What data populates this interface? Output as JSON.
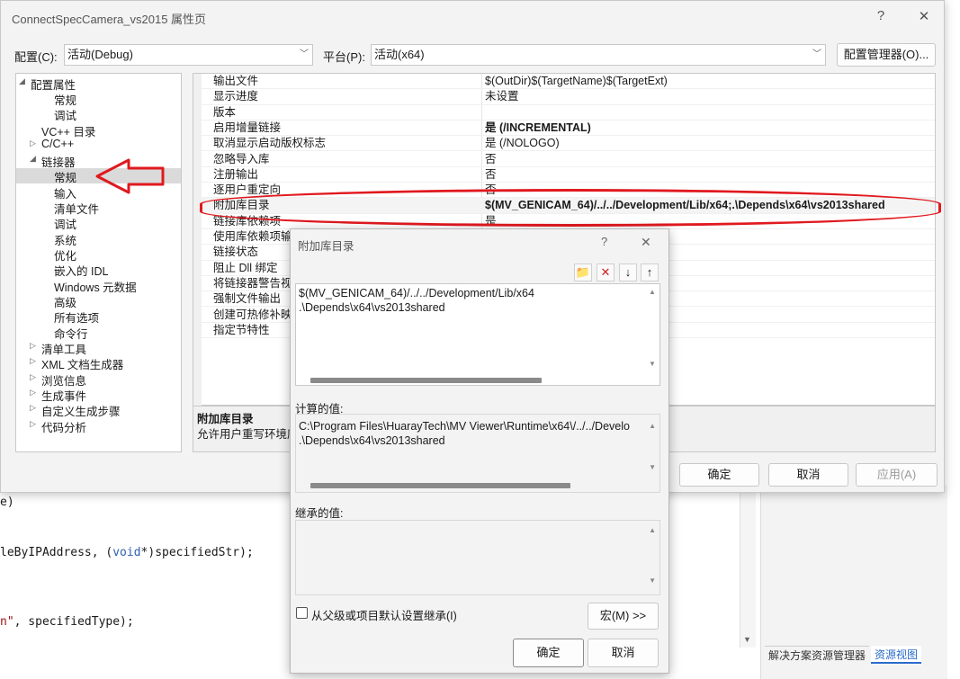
{
  "background": {
    "code_lines": [
      {
        "pre": "",
        "kw": "",
        "post": "e)"
      },
      {
        "pre": "leByIPAddress, (",
        "kw": "void",
        "post": "*)specifiedStr);"
      },
      {
        "pre": "",
        "kw": "",
        "str": "n\"",
        "post": ", specifiedType);"
      }
    ],
    "side_tabs": [
      "解决方案资源管理器",
      "资源视图"
    ]
  },
  "dialog": {
    "title": "ConnectSpecCamera_vs2015 属性页",
    "help_glyph": "?",
    "close_glyph": "✕",
    "config_label": "配置(C):",
    "config_value": "活动(Debug)",
    "platform_label": "平台(P):",
    "platform_value": "活动(x64)",
    "config_manager_button": "配置管理器(O)...",
    "tree": {
      "root": "配置属性",
      "items": [
        {
          "label": "常规"
        },
        {
          "label": "调试"
        },
        {
          "label": "VC++ 目录"
        },
        {
          "label": "C/C++"
        },
        {
          "label": "链接器"
        },
        {
          "label": "常规"
        },
        {
          "label": "输入"
        },
        {
          "label": "清单文件"
        },
        {
          "label": "调试"
        },
        {
          "label": "系统"
        },
        {
          "label": "优化"
        },
        {
          "label": "嵌入的 IDL"
        },
        {
          "label": "Windows 元数据"
        },
        {
          "label": "高级"
        },
        {
          "label": "所有选项"
        },
        {
          "label": "命令行"
        },
        {
          "label": "清单工具"
        },
        {
          "label": "XML 文档生成器"
        },
        {
          "label": "浏览信息"
        },
        {
          "label": "生成事件"
        },
        {
          "label": "自定义生成步骤"
        },
        {
          "label": "代码分析"
        }
      ]
    },
    "properties": [
      {
        "name": "输出文件",
        "value": "$(OutDir)$(TargetName)$(TargetExt)"
      },
      {
        "name": "显示进度",
        "value": "未设置"
      },
      {
        "name": "版本",
        "value": ""
      },
      {
        "name": "启用增量链接",
        "value": "是 (/INCREMENTAL)"
      },
      {
        "name": "取消显示启动版权标志",
        "value": "是 (/NOLOGO)"
      },
      {
        "name": "忽略导入库",
        "value": "否"
      },
      {
        "name": "注册输出",
        "value": "否"
      },
      {
        "name": "逐用户重定向",
        "value": "否"
      },
      {
        "name": "附加库目录",
        "value": "$(MV_GENICAM_64)/../../Development/Lib/x64;.\\Depends\\x64\\vs2013shared"
      },
      {
        "name": "链接库依赖项",
        "value": "是"
      },
      {
        "name": "使用库依赖项输入",
        "value": ""
      },
      {
        "name": "链接状态",
        "value": ""
      },
      {
        "name": "阻止 Dll 绑定",
        "value": ""
      },
      {
        "name": "将链接器警告视",
        "value": ""
      },
      {
        "name": "强制文件输出",
        "value": ""
      },
      {
        "name": "创建可热修补映",
        "value": ""
      },
      {
        "name": "指定节特性",
        "value": ""
      }
    ],
    "description": {
      "title": "附加库目录",
      "text": "允许用户重写环境库"
    },
    "ok_button": "确定",
    "cancel_button": "取消",
    "apply_button": "应用(A)"
  },
  "subdialog": {
    "title": "附加库目录",
    "help_glyph": "?",
    "close_glyph": "✕",
    "toolbar": {
      "new_folder": "📁",
      "delete": "✕",
      "down": "↓",
      "up": "↑"
    },
    "entries": [
      "$(MV_GENICAM_64)/../../Development/Lib/x64",
      ".\\Depends\\x64\\vs2013shared"
    ],
    "evaluated_label": "计算的值:",
    "evaluated": [
      "C:\\Program Files\\HuarayTech\\MV Viewer\\Runtime\\x64\\/../../Develo",
      ".\\Depends\\x64\\vs2013shared"
    ],
    "inherited_label": "继承的值:",
    "inherit_checkbox_label": "从父级或项目默认设置继承(I)",
    "macro_button": "宏(M) >>",
    "ok_button": "确定",
    "cancel_button": "取消"
  }
}
